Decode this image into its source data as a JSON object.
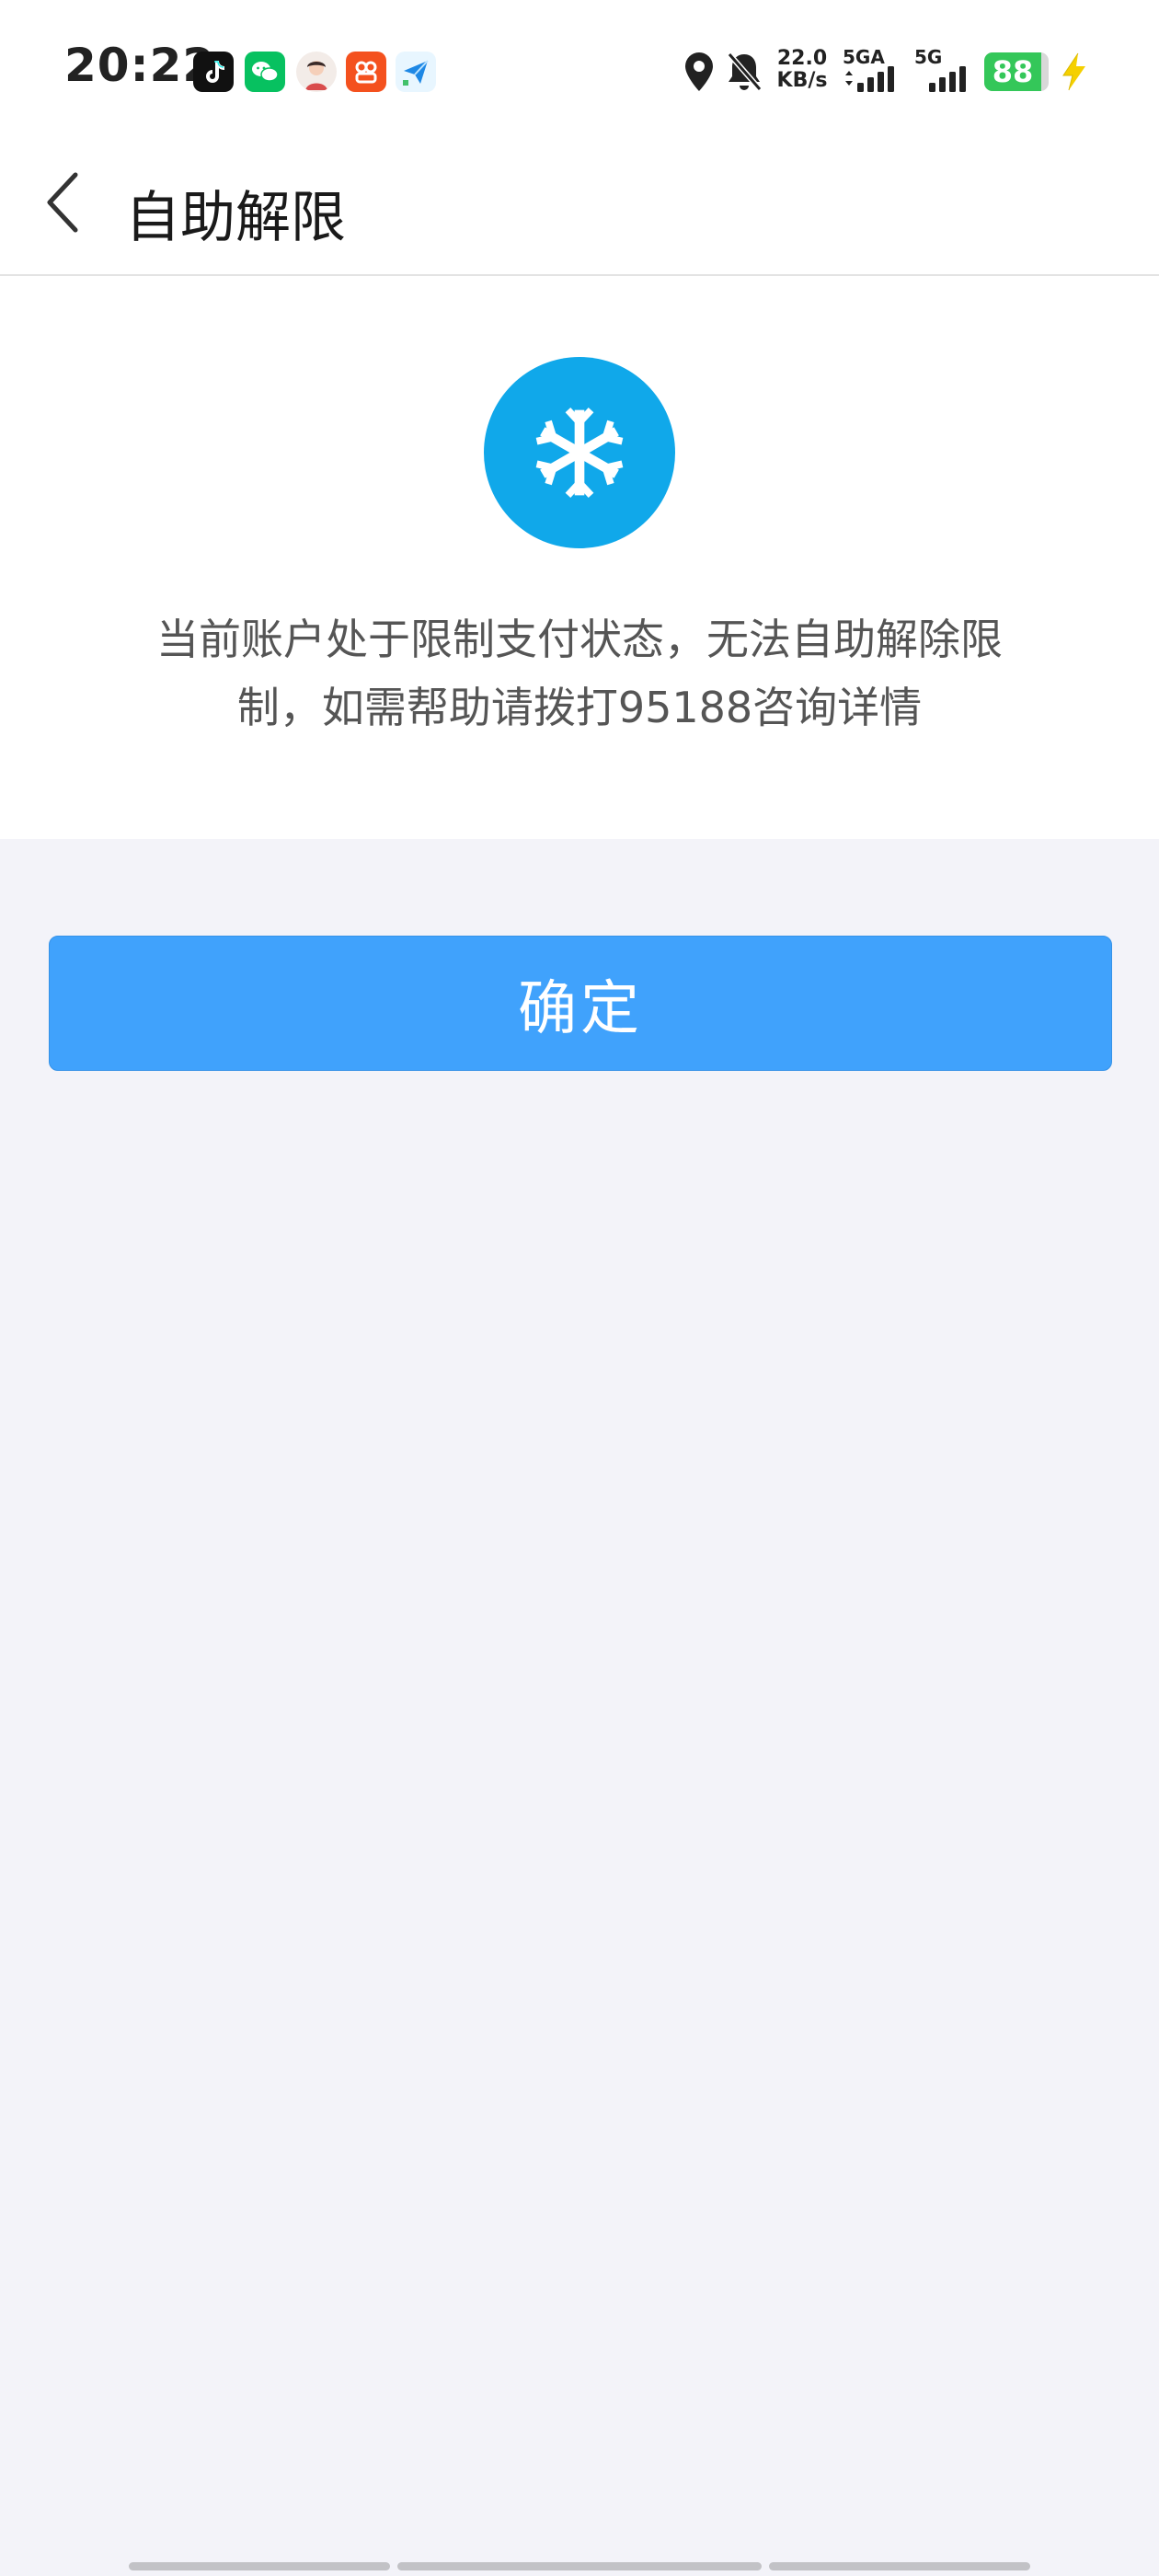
{
  "status_bar": {
    "time": "20:22",
    "net_speed_value": "22.0",
    "net_speed_unit": "KB/s",
    "sim1_label": "5GA",
    "sim2_label": "5G",
    "battery_level": "88",
    "battery_fraction": 0.88,
    "icons": [
      "douyin-icon",
      "wechat-icon",
      "avatar-app-icon",
      "orange-app-icon",
      "paper-plane-app-icon",
      "location-icon",
      "bell-muted-icon",
      "signal-icon",
      "signal-icon",
      "battery-icon",
      "charging-icon"
    ]
  },
  "nav": {
    "title": "自助解限",
    "back_icon": "chevron-left-icon"
  },
  "notice": {
    "icon": "snowflake-icon",
    "icon_color": "#10a8ea",
    "message_line1": "当前账户处于限制支付状态，无法自助解除限",
    "message_line2": "制，如需帮助请拨打95188咨询详情"
  },
  "actions": {
    "confirm_label": "确定",
    "confirm_color": "#40a2fc"
  }
}
